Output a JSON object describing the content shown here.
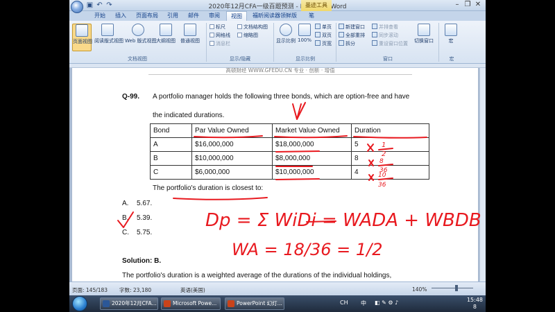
{
  "window": {
    "title": "2020年12月CFA一级百题预测 - Microsoft Word",
    "context_tab": "墨迹工具",
    "qat": [
      "save-icon",
      "undo-icon",
      "redo-icon"
    ]
  },
  "tabs": [
    "开始",
    "插入",
    "页面布局",
    "引用",
    "邮件",
    "审阅",
    "视图",
    "福昕阅读器领鲜版",
    "笔"
  ],
  "active_tab": "视图",
  "ribbon": {
    "doc_views": {
      "buttons": [
        "页面视图",
        "阅读版式视图",
        "Web 版式视图",
        "大纲视图",
        "普通视图"
      ],
      "label": "文档视图"
    },
    "show_hide": {
      "items": [
        "标尺",
        "网格线",
        "消息栏",
        "文档结构图",
        "缩略图"
      ],
      "label": "显示/隐藏"
    },
    "zoom": {
      "buttons": [
        "显示比例",
        "100%"
      ],
      "small": [
        "单页",
        "双页",
        "页宽"
      ],
      "label": "显示比例"
    },
    "window": {
      "buttons": [
        "新建窗口",
        "全部重排",
        "拆分",
        "并排查看",
        "同步滚动",
        "重设窗口位置",
        "切换窗口"
      ],
      "label": "窗口"
    },
    "macro": {
      "button": "宏",
      "label": "宏"
    }
  },
  "document": {
    "header": "高顿财经 WWW.GFEDU.CN 专业 · 创新 · 增值",
    "question_no": "Q-99.",
    "question_line1": "A portfolio manager holds the following three bonds, which are option-free and have",
    "question_line2": "the indicated durations.",
    "table": {
      "headers": [
        "Bond",
        "Par Value Owned",
        "Market Value Owned",
        "Duration"
      ],
      "rows": [
        [
          "A",
          "$16,000,000",
          "$18,000,000",
          "5"
        ],
        [
          "B",
          "$10,000,000",
          "$8,000,000",
          "8"
        ],
        [
          "C",
          "$6,000,000",
          "$10,000,000",
          "4"
        ]
      ]
    },
    "prompt": "The portfolio's duration is closest to:",
    "options": [
      {
        "letter": "A.",
        "value": "5.67."
      },
      {
        "letter": "B.",
        "value": "5.39."
      },
      {
        "letter": "C.",
        "value": "5.75."
      }
    ],
    "solution_label": "Solution: B.",
    "solution_text": "The portfolio's duration is a weighted average of the durations of the individual holdings,"
  },
  "ink_annotations": {
    "color": "#e8191f",
    "formula1": "Dp = Σ WiDi = WADA + WBDB + WCDC",
    "formula2": "WA = 18/36 = 1/2",
    "weights": [
      "1/2",
      "8/36",
      "10/36"
    ]
  },
  "statusbar": {
    "page": "页面: 145/183",
    "words": "字数: 23,180",
    "lang": "英语(美国)",
    "zoom": "140%"
  },
  "taskbar": {
    "tasks": [
      "2020年12月CFA...",
      "Microsoft Powe...",
      "PowerPoint 幻灯..."
    ],
    "ime": "CH",
    "tray_text": "中",
    "time": "15:48",
    "date": "8"
  }
}
